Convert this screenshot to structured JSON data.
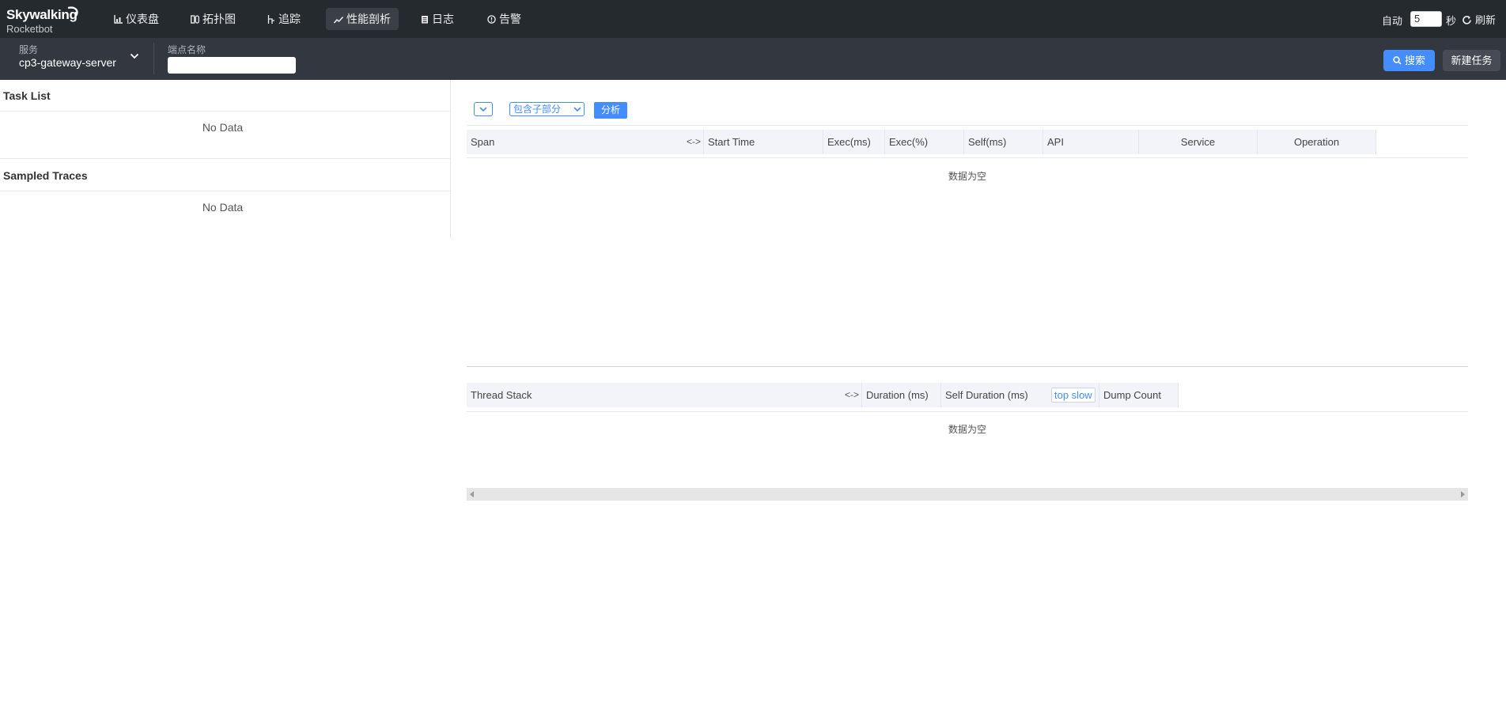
{
  "app": {
    "logo_text": "Skywalking",
    "logo_sub": "Rocketbot"
  },
  "nav": [
    {
      "label": "仪表盘",
      "icon": "bar-chart-icon"
    },
    {
      "label": "拓扑图",
      "icon": "topology-icon"
    },
    {
      "label": "追踪",
      "icon": "trace-icon"
    },
    {
      "label": "性能剖析",
      "icon": "line-chart-icon",
      "active": true
    },
    {
      "label": "日志",
      "icon": "log-icon"
    },
    {
      "label": "告警",
      "icon": "alarm-icon"
    }
  ],
  "auto_refresh": {
    "label": "自动",
    "interval": "5",
    "unit": "秒",
    "refresh_label": "刷新"
  },
  "toolbar": {
    "service_label": "服务",
    "service_value": "cp3-gateway-server",
    "endpoint_label": "端点名称",
    "endpoint_value": "",
    "search_label": "搜索",
    "new_task_label": "新建任务"
  },
  "task_list": {
    "title": "Task List",
    "empty": "No Data"
  },
  "sampled_traces": {
    "title": "Sampled Traces",
    "empty": "No Data"
  },
  "analysis": {
    "mode_value": "包含子部分",
    "analyze_label": "分析"
  },
  "span_table": {
    "columns": [
      "Span",
      "Start Time",
      "Exec(ms)",
      "Exec(%)",
      "Self(ms)",
      "API",
      "Service",
      "Operation"
    ],
    "resize_glyph": "<->",
    "empty": "数据为空"
  },
  "thread_table": {
    "columns": [
      "Thread Stack",
      "Duration (ms)",
      "Self Duration (ms)",
      "Dump Count"
    ],
    "top_slow_label": "top slow",
    "resize_glyph": "<->",
    "empty": "数据为空"
  },
  "colors": {
    "topbar_bg": "#252a2f",
    "toolbar_bg": "#333840",
    "accent": "#448dfe"
  }
}
